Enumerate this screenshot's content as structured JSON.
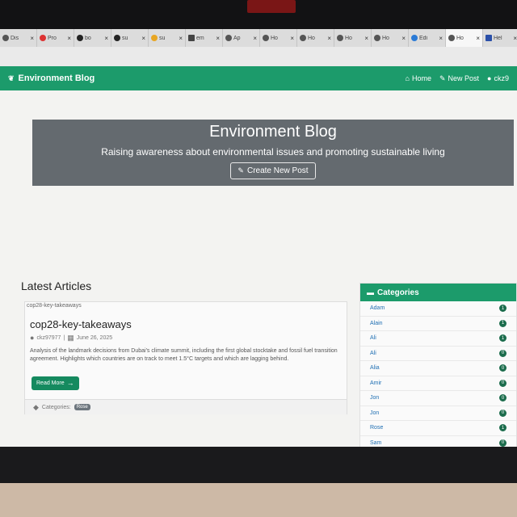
{
  "browser": {
    "tabs": [
      {
        "label": "Dis",
        "icon": "tab-icon"
      },
      {
        "label": "Pro",
        "icon": "opera-icon"
      },
      {
        "label": "bo",
        "icon": "github-icon"
      },
      {
        "label": "su",
        "icon": "github-icon"
      },
      {
        "label": "su",
        "icon": "google-icon"
      },
      {
        "label": "em",
        "icon": "notion-icon"
      },
      {
        "label": "Ap",
        "icon": "globe-icon"
      },
      {
        "label": "Ho",
        "icon": "globe-icon"
      },
      {
        "label": "Ho",
        "icon": "globe-icon"
      },
      {
        "label": "Ho",
        "icon": "globe-icon"
      },
      {
        "label": "Ho",
        "icon": "globe-icon"
      },
      {
        "label": "Edi",
        "icon": "vscode-icon"
      },
      {
        "label": "Ho",
        "icon": "globe-icon"
      },
      {
        "label": "Hel",
        "icon": "notion-icon"
      }
    ]
  },
  "navbar": {
    "brand": "Environment Blog",
    "links": {
      "home": "Home",
      "new_post": "New Post",
      "user": "ckz9"
    }
  },
  "hero": {
    "title": "Environment Blog",
    "subtitle": "Raising awareness about environmental issues and promoting sustainable living",
    "button": "Create New Post"
  },
  "latest": {
    "heading": "Latest Articles",
    "article": {
      "image_alt": "cop28-key-takeaways",
      "title": "cop28-key-takeaways",
      "author": "ckz97977",
      "date": "June 26, 2025",
      "description": "Analysis of the landmark decisions from Dubai's climate summit, including the first global stocktake and fossil fuel transition agreement. Highlights which countries are on track to meet 1.5°C targets and which are lagging behind.",
      "read_more": "Read More",
      "categories_label": "Categories:",
      "category_badge": "Rose"
    }
  },
  "categories": {
    "heading": "Categories",
    "items": [
      {
        "name": "Adam",
        "count": "1"
      },
      {
        "name": "Alain",
        "count": "1"
      },
      {
        "name": "Ali",
        "count": "1"
      },
      {
        "name": "Ali",
        "count": "0"
      },
      {
        "name": "Alia",
        "count": "0"
      },
      {
        "name": "Amir",
        "count": "0"
      },
      {
        "name": "Jon",
        "count": "0"
      },
      {
        "name": "Jon",
        "count": "0"
      },
      {
        "name": "Rose",
        "count": "1"
      },
      {
        "name": "Sam",
        "count": "0"
      }
    ]
  },
  "colors": {
    "primary": "#1c9b6b",
    "hero_bg": "#646a6f",
    "link": "#1f6fb3"
  }
}
